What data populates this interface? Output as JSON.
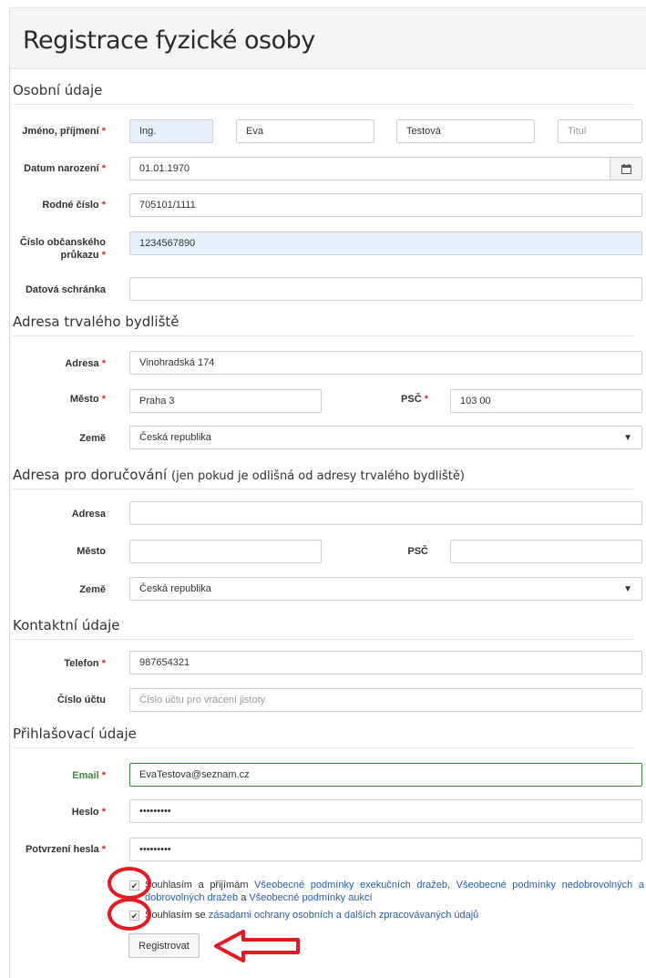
{
  "title": "Registrace fyzické osoby",
  "required_mark": "*",
  "sections": {
    "personal": "Osobní údaje",
    "permanent": "Adresa trvalého bydliště",
    "delivery": "Adresa pro doručování",
    "delivery_note": "(jen pokud je odlišná od adresy trvalého bydliště)",
    "contact": "Kontaktní údaje",
    "login": "Přihlašovací údaje"
  },
  "personal": {
    "name_label": "Jméno, příjmení",
    "degree_value": "Ing.",
    "first_name_value": "Eva",
    "last_name_value": "Testová",
    "title_placeholder": "Titul",
    "birth_label": "Datum narození",
    "birth_value": "01.01.1970",
    "birth_number_label": "Rodné číslo",
    "birth_number_value": "705101/1111",
    "id_card_label_1": "Číslo občanského",
    "id_card_label_2": "průkazu",
    "id_card_value": "1234567890",
    "databox_label": "Datová schránka",
    "databox_value": ""
  },
  "permanent": {
    "address_label": "Adresa",
    "address_value": "Vinohradská 174",
    "city_label": "Město",
    "city_value": "Praha 3",
    "zip_label": "PSČ",
    "zip_value": "103 00",
    "country_label": "Země",
    "country_value": "Česká republika"
  },
  "delivery": {
    "address_label": "Adresa",
    "city_label": "Město",
    "zip_label": "PSČ",
    "country_label": "Země",
    "country_value": "Česká republika"
  },
  "contact": {
    "phone_label": "Telefon",
    "phone_value": "987654321",
    "account_label": "Číslo účtu",
    "account_placeholder": "Číslo účtu pro vrácení jistoty"
  },
  "login": {
    "email_label": "Email",
    "email_value": "EvaTestova@seznam.cz",
    "password_label": "Heslo",
    "password_value": "•••••••••",
    "confirm_label": "Potvrzení hesla",
    "confirm_value": "•••••••••"
  },
  "agreements": {
    "terms_prefix": "Souhlasím a přijímám",
    "terms_link1": "Všeobecné podmínky exekučních dražeb,",
    "terms_link2": "Všeobecné podmínky nedobrovolných a dobrovolných dražeb",
    "terms_and": "a",
    "terms_link3": "Všeobecné podmínky aukcí",
    "privacy_prefix": "Souhlasím se",
    "privacy_link": "zásadami ochrany osobních a dalších zpracovávaných údajů",
    "checked_symbol": "✔"
  },
  "submit_label": "Registrovat",
  "colors": {
    "required": "#d9262e",
    "link": "#2a5db0",
    "annotation": "#e21b24",
    "autofill": "#e8f0fe"
  }
}
